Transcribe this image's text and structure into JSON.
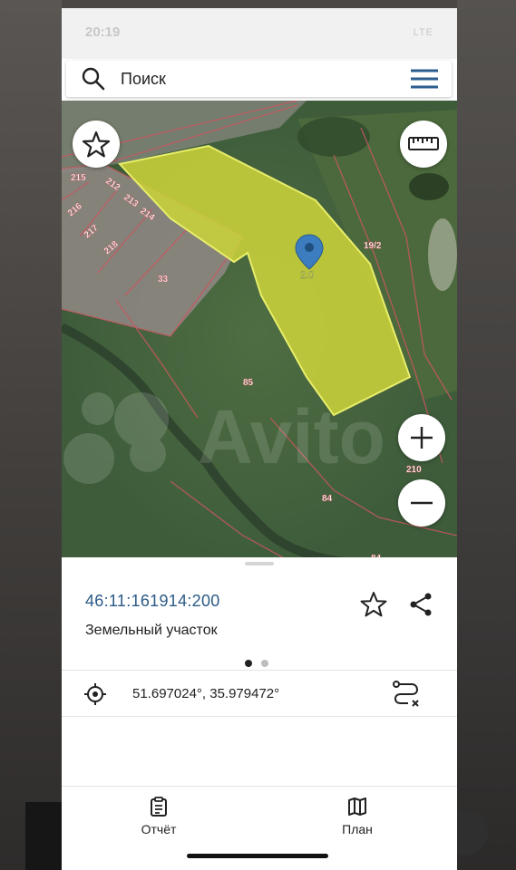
{
  "status_bar": {
    "time": "20:19",
    "network": "LTE"
  },
  "search": {
    "label": "Поиск"
  },
  "map": {
    "plot_labels": [
      "215",
      "212",
      "213",
      "214",
      "216",
      "217",
      "218",
      "33",
      "19/2",
      "85",
      "210",
      "84",
      "84",
      "2.0"
    ],
    "watermark": "Avito"
  },
  "sheet": {
    "cadastral_number": "46:11:161914:200",
    "parcel_type": "Земельный участок",
    "coordinates": "51.697024°, 35.979472°",
    "page_dots": {
      "active": 0,
      "count": 2
    }
  },
  "tabs": [
    {
      "label": "Отчёт"
    },
    {
      "label": "План"
    }
  ],
  "colors": {
    "accent": "#2b5a86",
    "parcel_fill": "#c9d23a",
    "parcel_stroke": "#e8ee6a",
    "boundary": "#c8585f",
    "menu": "#2d5e8e"
  },
  "icons": [
    "search-icon",
    "menu-icon",
    "star-icon",
    "ruler-icon",
    "plus-icon",
    "minus-icon",
    "location-pin-icon",
    "share-icon",
    "crosshair-icon",
    "route-icon",
    "report-icon",
    "map-icon"
  ]
}
